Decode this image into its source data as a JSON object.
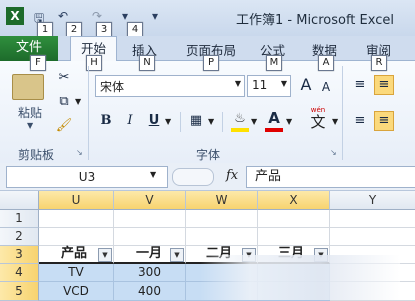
{
  "window": {
    "title": "工作簿1 - Microsoft Excel"
  },
  "qat": {
    "badges": [
      "1",
      "2",
      "3",
      "4"
    ]
  },
  "tabs": {
    "file": "文件",
    "home": "开始",
    "insert": "插入",
    "page_layout": "页面布局",
    "formulas": "公式",
    "data": "数据",
    "review": "审阅"
  },
  "keytips": {
    "file": "F",
    "home": "H",
    "insert": "N",
    "page_layout": "P",
    "formulas": "M",
    "data": "A",
    "review": "R"
  },
  "clipboard": {
    "paste_label": "粘贴",
    "group_label": "剪贴板"
  },
  "font": {
    "name": "宋体",
    "size": "11",
    "group_label": "字体",
    "grow_label": "A",
    "shrink_label": "A",
    "bold": "B",
    "italic": "I",
    "underline": "U",
    "font_color_label": "A",
    "phonetic_label": "wén",
    "phonetic_char": "文"
  },
  "formula_bar": {
    "name_box": "U3",
    "fx_label": "fx",
    "content": "产品"
  },
  "grid": {
    "columns": [
      "U",
      "V",
      "W",
      "X",
      "Y"
    ],
    "rows": [
      "1",
      "2",
      "3",
      "4",
      "5"
    ],
    "table": {
      "headers": [
        "产品",
        "一月",
        "二月",
        "三月"
      ],
      "rows": [
        [
          "TV",
          "300"
        ],
        [
          "VCD",
          "400"
        ]
      ]
    }
  },
  "colors": {
    "accent": "#1d6b2b",
    "selection": "#c7ddf4",
    "header_highlight": "#f7d36f"
  }
}
